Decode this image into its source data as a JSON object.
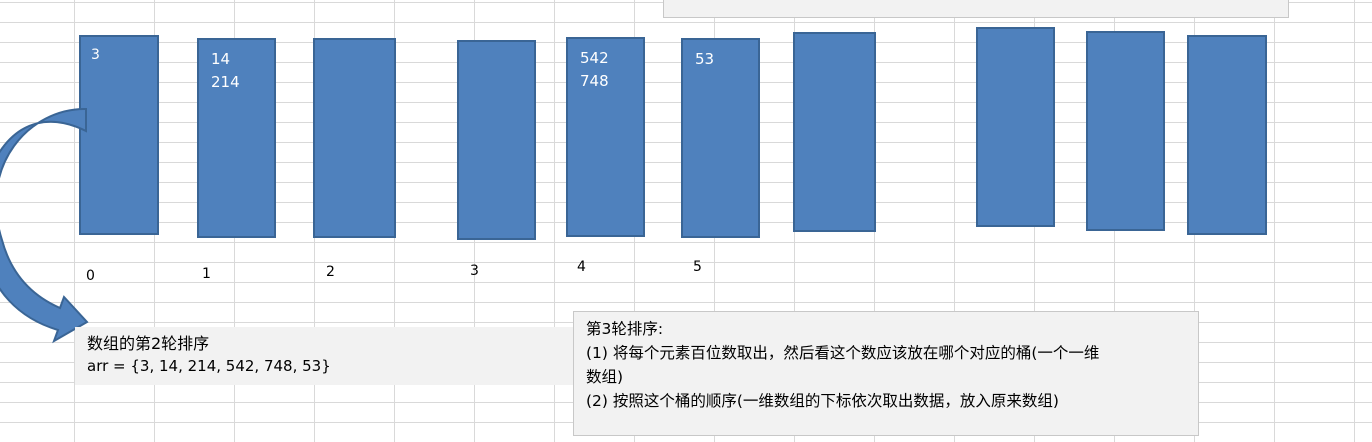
{
  "buckets": [
    {
      "values": [
        "3"
      ]
    },
    {
      "values": [
        "14",
        "214"
      ]
    },
    {
      "values": []
    },
    {
      "values": []
    },
    {
      "values": [
        "542",
        "748"
      ]
    },
    {
      "values": [
        "53"
      ]
    },
    {
      "values": []
    },
    {
      "values": []
    },
    {
      "values": []
    },
    {
      "values": []
    }
  ],
  "indices": [
    "0",
    "1",
    "2",
    "3",
    "4",
    "5"
  ],
  "note_left": {
    "title": "数组的第2轮排序",
    "code": "arr = {3, 14, 214, 542, 748, 53}"
  },
  "note_right": {
    "heading": "第3轮排序:",
    "line1a": "(1) 将每个元素百位数取出，然后看这个数应该放在哪个对应的桶(一个一维",
    "line1b": "数组)",
    "line2": "(2) 按照这个桶的顺序(一维数组的下标依次取出数据，放入原来数组)"
  },
  "colors": {
    "bucket_fill": "#4f81bd",
    "bucket_border": "#3a6595",
    "note_bg": "#f2f2f2"
  }
}
